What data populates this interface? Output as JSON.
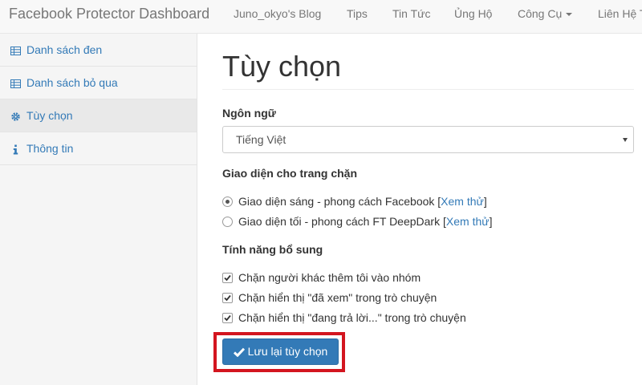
{
  "navbar": {
    "brand": "Facebook Protector Dashboard",
    "items": [
      {
        "label": "Juno_okyo's Blog"
      },
      {
        "label": "Tips"
      },
      {
        "label": "Tin Tức"
      },
      {
        "label": "Ủng Hộ"
      },
      {
        "label": "Công Cụ",
        "has_dropdown": true
      },
      {
        "label": "Liên Hệ T"
      }
    ]
  },
  "sidebar": {
    "items": [
      {
        "label": "Danh sách đen",
        "icon": "table-icon"
      },
      {
        "label": "Danh sách bỏ qua",
        "icon": "table-icon"
      },
      {
        "label": "Tùy chọn",
        "icon": "gear-icon",
        "active": true
      },
      {
        "label": "Thông tin",
        "icon": "info-icon"
      }
    ]
  },
  "main": {
    "title": "Tùy chọn",
    "language": {
      "label": "Ngôn ngữ",
      "selected": "Tiếng Việt"
    },
    "theme": {
      "label": "Giao diện cho trang chặn",
      "options": [
        {
          "text": "Giao diện sáng - phong cách Facebook [",
          "link": "Xem thử",
          "suffix": "]",
          "checked": true
        },
        {
          "text": "Giao diện tối - phong cách FT DeepDark [",
          "link": "Xem thử",
          "suffix": "]",
          "checked": false
        }
      ]
    },
    "extras": {
      "label": "Tính năng bổ sung",
      "options": [
        {
          "text": "Chặn người khác thêm tôi vào nhóm",
          "checked": true
        },
        {
          "text": "Chặn hiển thị \"đã xem\" trong trò chuyện",
          "checked": true
        },
        {
          "text": "Chặn hiển thị \"đang trả lời...\" trong trò chuyện",
          "checked": true
        }
      ]
    },
    "save_label": "Lưu lại tùy chọn"
  },
  "colors": {
    "link": "#337ab7",
    "primary_button": "#337ab7",
    "highlight_border": "#d3151f"
  }
}
